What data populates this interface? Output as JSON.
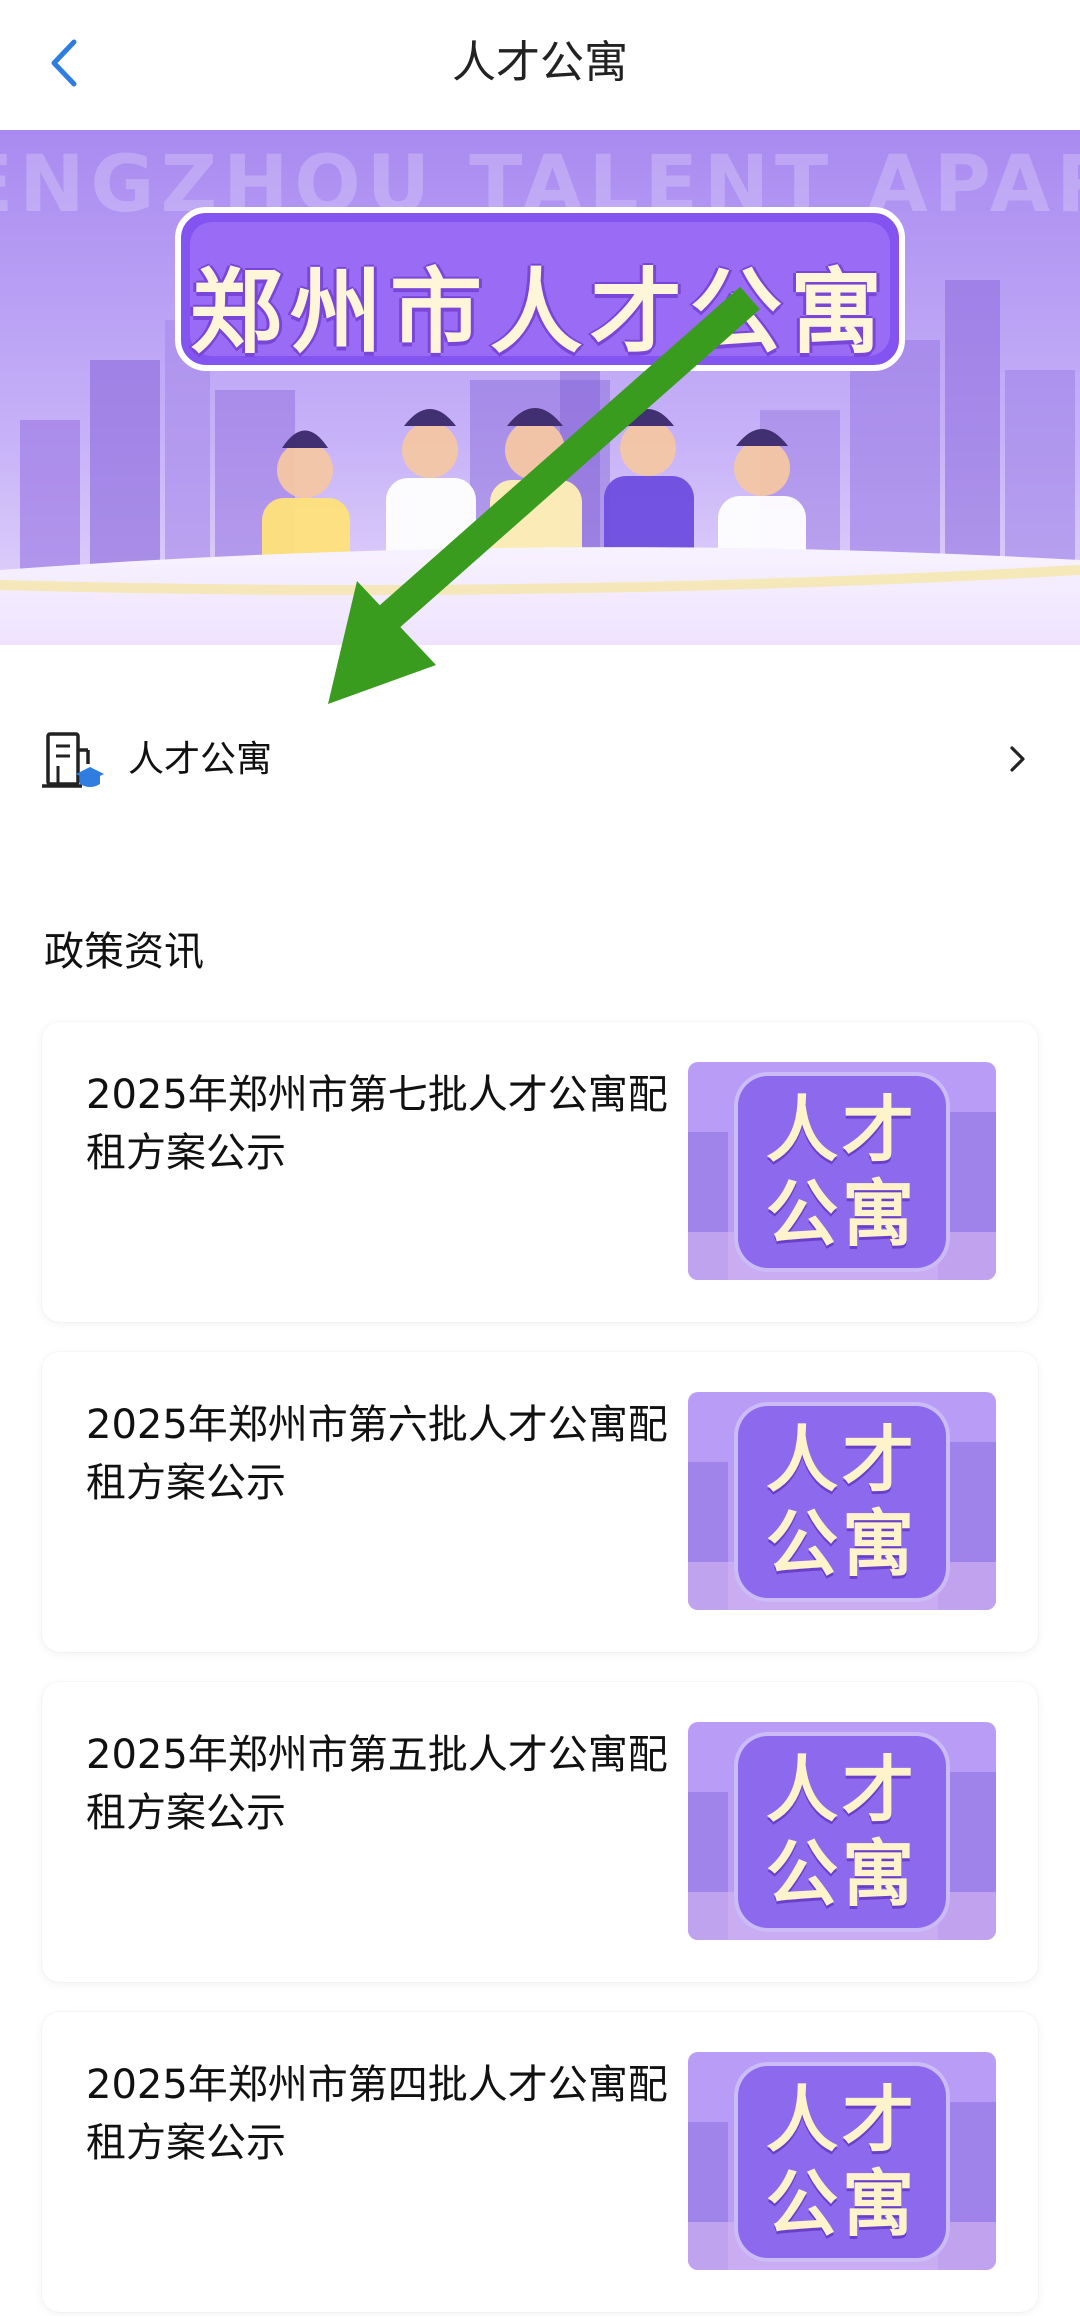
{
  "header": {
    "title": "人才公寓",
    "back_icon": "chevron-left-icon"
  },
  "banner": {
    "title": "郑州市人才公寓",
    "background_text": "ENGZHOU TALENT APARTME",
    "colors": {
      "sky": "#b79cf5",
      "accent": "#8c5cf0",
      "title_text": "#fff6d9"
    }
  },
  "entry": {
    "label": "人才公寓",
    "icon": "building-graduation-icon",
    "chevron": "chevron-right-icon"
  },
  "policy": {
    "title": "政策资讯",
    "articles": [
      {
        "title": "2025年郑州市第七批人才公寓配租方案公示",
        "thumb_line1": "人才",
        "thumb_line2": "公寓"
      },
      {
        "title": "2025年郑州市第六批人才公寓配租方案公示",
        "thumb_line1": "人才",
        "thumb_line2": "公寓"
      },
      {
        "title": "2025年郑州市第五批人才公寓配租方案公示",
        "thumb_line1": "人才",
        "thumb_line2": "公寓"
      },
      {
        "title": "2025年郑州市第四批人才公寓配租方案公示",
        "thumb_line1": "人才",
        "thumb_line2": "公寓"
      }
    ]
  },
  "annotation": {
    "arrow_color": "#3a9c1e"
  }
}
